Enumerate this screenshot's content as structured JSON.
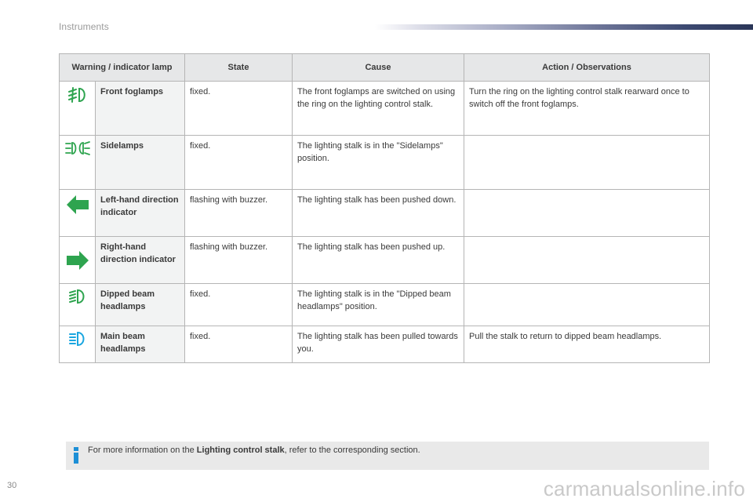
{
  "header": {
    "section_title": "Instruments"
  },
  "table": {
    "columns": [
      "Warning / indicator lamp",
      "State",
      "Cause",
      "Action / Observations"
    ],
    "rows": [
      {
        "icon": "front-foglamps-icon",
        "icon_color": "#2ea44f",
        "name": "Front foglamps",
        "state": "fixed.",
        "cause": "The front foglamps are switched on using the ring on the lighting control stalk.",
        "action": "Turn the ring on the lighting control stalk rearward once to switch off the front foglamps."
      },
      {
        "icon": "sidelamps-icon",
        "icon_color": "#2ea44f",
        "name": "Sidelamps",
        "state": "fixed.",
        "cause": "The lighting stalk is in the \"Sidelamps\" position.",
        "action": ""
      },
      {
        "icon": "left-arrow-icon",
        "icon_color": "#2ea44f",
        "name": "Left-hand direction indicator",
        "state": "flashing with buzzer.",
        "cause": "The lighting stalk has been pushed down.",
        "action": ""
      },
      {
        "icon": "right-arrow-icon",
        "icon_color": "#2ea44f",
        "name": "Right-hand direction indicator",
        "state": "flashing with buzzer.",
        "cause": "The lighting stalk has been pushed up.",
        "action": ""
      },
      {
        "icon": "dipped-beam-icon",
        "icon_color": "#2ea44f",
        "name": "Dipped beam headlamps",
        "state": "fixed.",
        "cause": "The lighting stalk is in the \"Dipped beam headlamps\" position.",
        "action": ""
      },
      {
        "icon": "main-beam-icon",
        "icon_color": "#1aa6e0",
        "name": "Main beam headlamps",
        "state": "fixed.",
        "cause": "The lighting stalk has been pulled towards you.",
        "action": "Pull the stalk to return to dipped beam headlamps."
      }
    ]
  },
  "info_box": {
    "icon": "info-icon",
    "icon_color": "#1d8fd6",
    "text_before": "For more information on the ",
    "text_bold": "Lighting control stalk",
    "text_after": ", refer to the corresponding section."
  },
  "footer": {
    "page_number": "30",
    "watermark": "carmanualsonline.info"
  }
}
